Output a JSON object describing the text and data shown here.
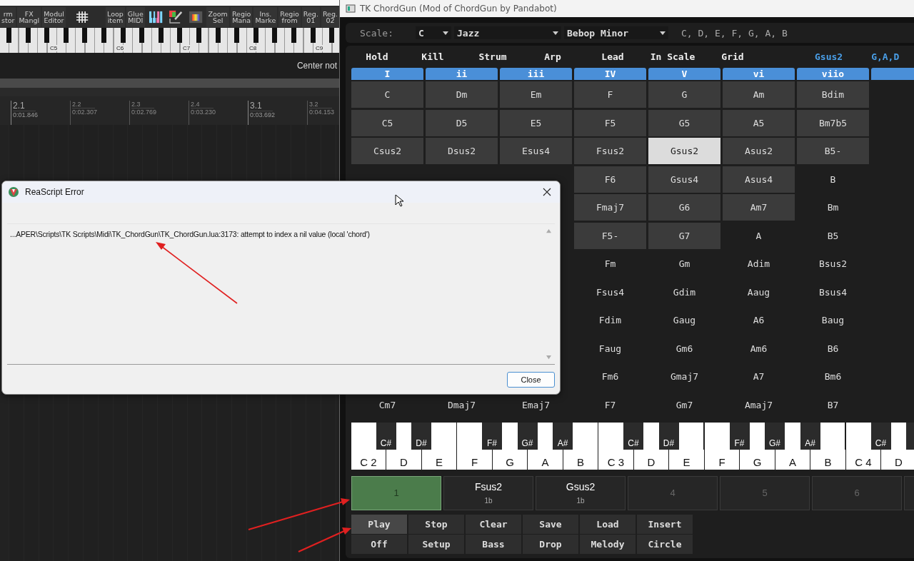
{
  "reaper": {
    "toolbar": [
      {
        "kind": "text",
        "lines": [
          "rm",
          "stor"
        ]
      },
      {
        "kind": "text",
        "lines": [
          "FX",
          "Mangl"
        ]
      },
      {
        "kind": "text",
        "lines": [
          "Modul",
          "Editor"
        ]
      },
      {
        "kind": "grid"
      },
      {
        "kind": "text",
        "lines": [
          "Loop",
          "item"
        ]
      },
      {
        "kind": "text",
        "lines": [
          "Glue",
          "MIDI"
        ]
      },
      {
        "kind": "piano"
      },
      {
        "kind": "paint"
      },
      {
        "kind": "color"
      },
      {
        "kind": "text",
        "lines": [
          "Zoom",
          "Sel"
        ]
      },
      {
        "kind": "text",
        "lines": [
          "Regio",
          "Mana"
        ]
      },
      {
        "kind": "text",
        "lines": [
          "Ins.",
          "Marke"
        ]
      },
      {
        "kind": "text",
        "lines": [
          "Regio",
          "from"
        ]
      },
      {
        "kind": "text",
        "lines": [
          "Reg.",
          "01"
        ]
      },
      {
        "kind": "text",
        "lines": [
          "Reg.",
          "02"
        ]
      }
    ],
    "octave_labels": [
      "C5",
      "C6",
      "C7",
      "C8",
      "C9"
    ],
    "center_label": "Center not",
    "ruler": [
      {
        "bar": "2.1",
        "time": "0:01.846",
        "major": true
      },
      {
        "bar": "2.2",
        "time": "0:02.307",
        "major": false
      },
      {
        "bar": "2.3",
        "time": "0:02.769",
        "major": false
      },
      {
        "bar": "2.4",
        "time": "0:03.230",
        "major": false
      },
      {
        "bar": "3.1",
        "time": "0:03.692",
        "major": true
      },
      {
        "bar": "3.2",
        "time": "0:04.153",
        "major": false
      }
    ]
  },
  "chordgun": {
    "title": "TK ChordGun (Mod of ChordGun by Pandabot)",
    "scale": {
      "label": "Scale:",
      "root": "C",
      "type": "Jazz",
      "mode": "Bebop Minor",
      "notes": "C, D, E, F, G, A, B"
    },
    "toggles": [
      "Hold",
      "Kill",
      "Strum",
      "Arp",
      "Lead",
      "In Scale",
      "Grid"
    ],
    "current_chord": "Gsus2",
    "current_notes": "G,A,D",
    "degrees": [
      "I",
      "ii",
      "iii",
      "IV",
      "V",
      "vi",
      "viio"
    ],
    "grid": [
      {
        "cells": [
          {
            "chord": "C",
            "filled": true,
            "selected": false
          },
          {
            "chord": "Dm",
            "filled": true,
            "selected": false
          },
          {
            "chord": "Em",
            "filled": true,
            "selected": false
          },
          {
            "chord": "F",
            "filled": true,
            "selected": false
          },
          {
            "chord": "G",
            "filled": true,
            "selected": false
          },
          {
            "chord": "Am",
            "filled": true,
            "selected": false
          },
          {
            "chord": "Bdim",
            "filled": true,
            "selected": false
          }
        ]
      },
      {
        "cells": [
          {
            "chord": "C5",
            "filled": true,
            "selected": false
          },
          {
            "chord": "D5",
            "filled": true,
            "selected": false
          },
          {
            "chord": "E5",
            "filled": true,
            "selected": false
          },
          {
            "chord": "F5",
            "filled": true,
            "selected": false
          },
          {
            "chord": "G5",
            "filled": true,
            "selected": false
          },
          {
            "chord": "A5",
            "filled": true,
            "selected": false
          },
          {
            "chord": "Bm7b5",
            "filled": true,
            "selected": false
          }
        ]
      },
      {
        "cells": [
          {
            "chord": "Csus2",
            "filled": true,
            "selected": false
          },
          {
            "chord": "Dsus2",
            "filled": true,
            "selected": false
          },
          {
            "chord": "Esus4",
            "filled": true,
            "selected": false
          },
          {
            "chord": "Fsus2",
            "filled": true,
            "selected": false
          },
          {
            "chord": "Gsus2",
            "filled": true,
            "selected": true
          },
          {
            "chord": "Asus2",
            "filled": true,
            "selected": false
          },
          {
            "chord": "B5-",
            "filled": true,
            "selected": false
          }
        ]
      },
      {
        "cells": [
          {
            "chord": "F6",
            "filled": true,
            "selected": false
          },
          {
            "chord": "Gsus4",
            "filled": true,
            "selected": false
          },
          {
            "chord": "Asus4",
            "filled": true,
            "selected": false
          },
          {
            "chord": "B",
            "filled": false,
            "selected": false
          }
        ]
      },
      {
        "cells": [
          {
            "chord": "Fmaj7",
            "filled": true,
            "selected": false
          },
          {
            "chord": "G6",
            "filled": true,
            "selected": false
          },
          {
            "chord": "Am7",
            "filled": true,
            "selected": false
          },
          {
            "chord": "Bm",
            "filled": false,
            "selected": false
          }
        ]
      },
      {
        "cells": [
          {
            "chord": "F5-",
            "filled": true,
            "selected": false
          },
          {
            "chord": "G7",
            "filled": true,
            "selected": false
          },
          {
            "chord": "A",
            "filled": false,
            "selected": false
          },
          {
            "chord": "B5",
            "filled": false,
            "selected": false
          }
        ]
      },
      {
        "cells": [
          {
            "chord": "Fm",
            "filled": false,
            "selected": false
          },
          {
            "chord": "Gm",
            "filled": false,
            "selected": false
          },
          {
            "chord": "Adim",
            "filled": false,
            "selected": false
          },
          {
            "chord": "Bsus2",
            "filled": false,
            "selected": false
          }
        ]
      },
      {
        "cells": [
          {
            "chord": "Fsus4",
            "filled": false,
            "selected": false
          },
          {
            "chord": "Gdim",
            "filled": false,
            "selected": false
          },
          {
            "chord": "Aaug",
            "filled": false,
            "selected": false
          },
          {
            "chord": "Bsus4",
            "filled": false,
            "selected": false
          }
        ]
      },
      {
        "cells": [
          {
            "chord": "Fdim",
            "filled": false,
            "selected": false
          },
          {
            "chord": "Gaug",
            "filled": false,
            "selected": false
          },
          {
            "chord": "A6",
            "filled": false,
            "selected": false
          },
          {
            "chord": "Baug",
            "filled": false,
            "selected": false
          }
        ]
      },
      {
        "cells": [
          {
            "chord": "Faug",
            "filled": false,
            "selected": false
          },
          {
            "chord": "Gm6",
            "filled": false,
            "selected": false
          },
          {
            "chord": "Am6",
            "filled": false,
            "selected": false
          },
          {
            "chord": "B6",
            "filled": false,
            "selected": false
          }
        ]
      },
      {
        "cells": [
          {
            "chord": "Fm6",
            "filled": false,
            "selected": false
          },
          {
            "chord": "Gmaj7",
            "filled": false,
            "selected": false
          },
          {
            "chord": "A7",
            "filled": false,
            "selected": false
          },
          {
            "chord": "Bm6",
            "filled": false,
            "selected": false
          }
        ]
      },
      {
        "cells": [
          {
            "chord": "Cm7",
            "filled": false,
            "selected": false
          },
          {
            "chord": "Dmaj7",
            "filled": false,
            "selected": false
          },
          {
            "chord": "Emaj7",
            "filled": false,
            "selected": false
          },
          {
            "chord": "F7",
            "filled": false,
            "selected": false
          },
          {
            "chord": "Gm7",
            "filled": false,
            "selected": false
          },
          {
            "chord": "Amaj7",
            "filled": false,
            "selected": false
          },
          {
            "chord": "B7",
            "filled": false,
            "selected": false
          }
        ]
      }
    ],
    "piano": {
      "white": [
        "C 2",
        "D",
        "E",
        "F",
        "G",
        "A",
        "B",
        "C 3",
        "D",
        "E",
        "F",
        "G",
        "A",
        "B",
        "C 4",
        "D"
      ],
      "black": [
        "C#",
        "D#",
        "F#",
        "G#",
        "A#",
        "C#",
        "D#",
        "F#",
        "G#",
        "A#",
        "C#"
      ]
    },
    "slots": [
      {
        "kind": "empty",
        "number": "1",
        "selected": true
      },
      {
        "kind": "chord",
        "chord": "Fsus2",
        "length": "1b",
        "selected": false
      },
      {
        "kind": "chord",
        "chord": "Gsus2",
        "length": "1b",
        "selected": false
      },
      {
        "kind": "empty",
        "number": "4",
        "selected": false
      },
      {
        "kind": "empty",
        "number": "5",
        "selected": false
      },
      {
        "kind": "empty",
        "number": "6",
        "selected": false
      }
    ],
    "buttons": [
      [
        {
          "label": "Play",
          "highlighted": true
        },
        {
          "label": "Stop",
          "highlighted": false
        },
        {
          "label": "Clear",
          "highlighted": false
        },
        {
          "label": "Save",
          "highlighted": false
        },
        {
          "label": "Load",
          "highlighted": false
        },
        {
          "label": "Insert",
          "highlighted": false
        }
      ],
      [
        {
          "label": "Off",
          "highlighted": false
        },
        {
          "label": "Setup",
          "highlighted": false
        },
        {
          "label": "Bass",
          "highlighted": false
        },
        {
          "label": "Drop",
          "highlighted": false
        },
        {
          "label": "Melody",
          "highlighted": false
        },
        {
          "label": "Circle",
          "highlighted": false
        }
      ]
    ]
  },
  "error_dialog": {
    "title": "ReaScript Error",
    "message": "...APER\\Scripts\\TK Scripts\\Midi\\TK_ChordGun\\TK_ChordGun.lua:3173: attempt to index a nil value (local 'chord')",
    "button": "Close"
  }
}
